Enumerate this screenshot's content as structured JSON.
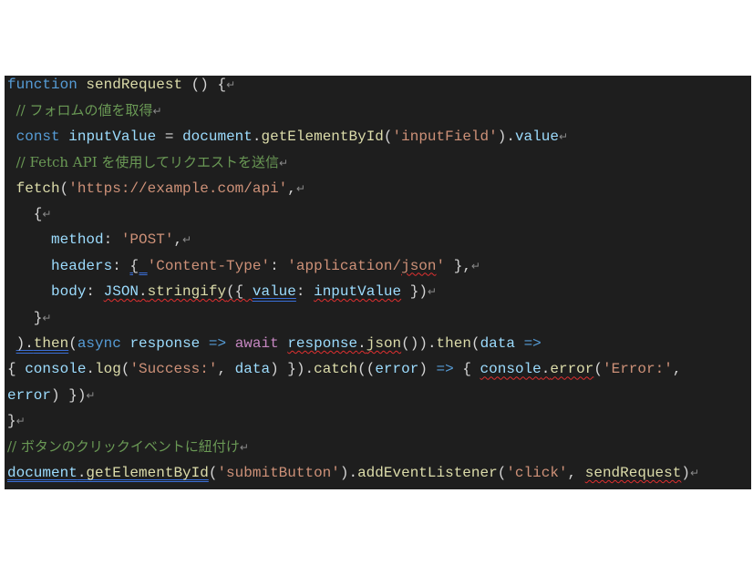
{
  "document": {
    "return_mark": "↵",
    "colors": {
      "background": "#1e1e1e",
      "keyword": "#569cd6",
      "variable": "#9cdcfe",
      "function": "#dcdcaa",
      "string": "#ce9178",
      "comment": "#6a9955",
      "await": "#c586c0",
      "plain": "#d4d4d4"
    },
    "lines": [
      {
        "ret": true,
        "tokens": [
          {
            "t": "function",
            "c": "kw"
          },
          {
            "t": " "
          },
          {
            "t": "sendRequest",
            "c": "fn"
          },
          {
            "t": " () {"
          }
        ]
      },
      {
        "ret": true,
        "tokens": [
          {
            "t": " "
          },
          {
            "t": "// フォロムの値を取得",
            "c": "cm"
          }
        ]
      },
      {
        "ret": true,
        "tokens": [
          {
            "t": " "
          },
          {
            "t": "const",
            "c": "kw"
          },
          {
            "t": " "
          },
          {
            "t": "inputValue",
            "c": "var"
          },
          {
            "t": " = "
          },
          {
            "t": "document",
            "c": "var"
          },
          {
            "t": "."
          },
          {
            "t": "getElementById",
            "c": "fn"
          },
          {
            "t": "("
          },
          {
            "t": "'inputField'",
            "c": "str"
          },
          {
            "t": ")."
          },
          {
            "t": "value",
            "c": "var"
          }
        ]
      },
      {
        "ret": true,
        "tokens": [
          {
            "t": " "
          },
          {
            "t": "// Fetch API を使用してリクエストを送信",
            "c": "cm"
          }
        ]
      },
      {
        "ret": true,
        "tokens": [
          {
            "t": " "
          },
          {
            "t": "fetch",
            "c": "fn"
          },
          {
            "t": "("
          },
          {
            "t": "'https://example.com/api'",
            "c": "str"
          },
          {
            "t": ","
          }
        ]
      },
      {
        "ret": true,
        "tokens": [
          {
            "t": "   {"
          }
        ]
      },
      {
        "ret": true,
        "tokens": [
          {
            "t": "     "
          },
          {
            "t": "method",
            "c": "var"
          },
          {
            "t": ": "
          },
          {
            "t": "'POST'",
            "c": "str"
          },
          {
            "t": ","
          }
        ]
      },
      {
        "ret": true,
        "tokens": [
          {
            "t": "     "
          },
          {
            "t": "headers",
            "c": "var"
          },
          {
            "t": ": "
          },
          {
            "t": "{ ",
            "c": "pl bu"
          },
          {
            "t": "'Content-Type'",
            "c": "str"
          },
          {
            "t": ": "
          },
          {
            "t": "'application/",
            "c": "str"
          },
          {
            "t": "json",
            "c": "str sq"
          },
          {
            "t": "'",
            "c": "str"
          },
          {
            "t": " },"
          }
        ]
      },
      {
        "ret": true,
        "tokens": [
          {
            "t": "     "
          },
          {
            "t": "body",
            "c": "var"
          },
          {
            "t": ": "
          },
          {
            "t": "JSON",
            "c": "var sq"
          },
          {
            "t": ".",
            "c": "pl sq"
          },
          {
            "t": "stringify",
            "c": "fn sq"
          },
          {
            "t": "({ ",
            "c": "pl sq"
          },
          {
            "t": "value",
            "c": "var bu"
          },
          {
            "t": ": "
          },
          {
            "t": "inputValue",
            "c": "var sq"
          },
          {
            "t": " })"
          }
        ]
      },
      {
        "ret": true,
        "tokens": [
          {
            "t": "   }"
          }
        ]
      },
      {
        "ret": false,
        "tokens": [
          {
            "t": " "
          },
          {
            "t": ").",
            "c": "pl bu"
          },
          {
            "t": "then",
            "c": "fn bu"
          },
          {
            "t": "("
          },
          {
            "t": "async",
            "c": "kw"
          },
          {
            "t": " "
          },
          {
            "t": "response",
            "c": "var"
          },
          {
            "t": " "
          },
          {
            "t": "=>",
            "c": "kw"
          },
          {
            "t": " "
          },
          {
            "t": "await",
            "c": "aw"
          },
          {
            "t": " "
          },
          {
            "t": "response",
            "c": "var sq"
          },
          {
            "t": ".",
            "c": "pl sq"
          },
          {
            "t": "json",
            "c": "fn sq"
          },
          {
            "t": "())."
          },
          {
            "t": "then",
            "c": "fn"
          },
          {
            "t": "("
          },
          {
            "t": "data",
            "c": "var"
          },
          {
            "t": " "
          },
          {
            "t": "=>",
            "c": "kw"
          }
        ]
      },
      {
        "ret": false,
        "tokens": [
          {
            "t": "{ "
          },
          {
            "t": "console",
            "c": "var"
          },
          {
            "t": "."
          },
          {
            "t": "log",
            "c": "fn"
          },
          {
            "t": "("
          },
          {
            "t": "'Success:'",
            "c": "str"
          },
          {
            "t": ", "
          },
          {
            "t": "data",
            "c": "var"
          },
          {
            "t": ") })."
          },
          {
            "t": "catch",
            "c": "fn"
          },
          {
            "t": "(("
          },
          {
            "t": "error",
            "c": "var"
          },
          {
            "t": ") "
          },
          {
            "t": "=>",
            "c": "kw"
          },
          {
            "t": " { "
          },
          {
            "t": "console",
            "c": "var sq"
          },
          {
            "t": ".",
            "c": "pl sq"
          },
          {
            "t": "error",
            "c": "fn sq"
          },
          {
            "t": "("
          },
          {
            "t": "'Error:'",
            "c": "str"
          },
          {
            "t": ","
          }
        ]
      },
      {
        "ret": true,
        "tokens": [
          {
            "t": "error",
            "c": "var"
          },
          {
            "t": ") })"
          }
        ]
      },
      {
        "ret": true,
        "tokens": [
          {
            "t": "}"
          }
        ]
      },
      {
        "ret": true,
        "tokens": [
          {
            "t": "// ボタンのクリックイベントに紐付け",
            "c": "cm"
          }
        ]
      },
      {
        "ret": true,
        "tokens": [
          {
            "t": "document",
            "c": "var bu"
          },
          {
            "t": ".",
            "c": "pl bu"
          },
          {
            "t": "getElementById",
            "c": "fn bu"
          },
          {
            "t": "("
          },
          {
            "t": "'submitButton'",
            "c": "str"
          },
          {
            "t": ")."
          },
          {
            "t": "addEventListener",
            "c": "fn"
          },
          {
            "t": "("
          },
          {
            "t": "'click'",
            "c": "str"
          },
          {
            "t": ", "
          },
          {
            "t": "sendRequest",
            "c": "fn sq"
          },
          {
            "t": ")"
          }
        ]
      }
    ]
  }
}
